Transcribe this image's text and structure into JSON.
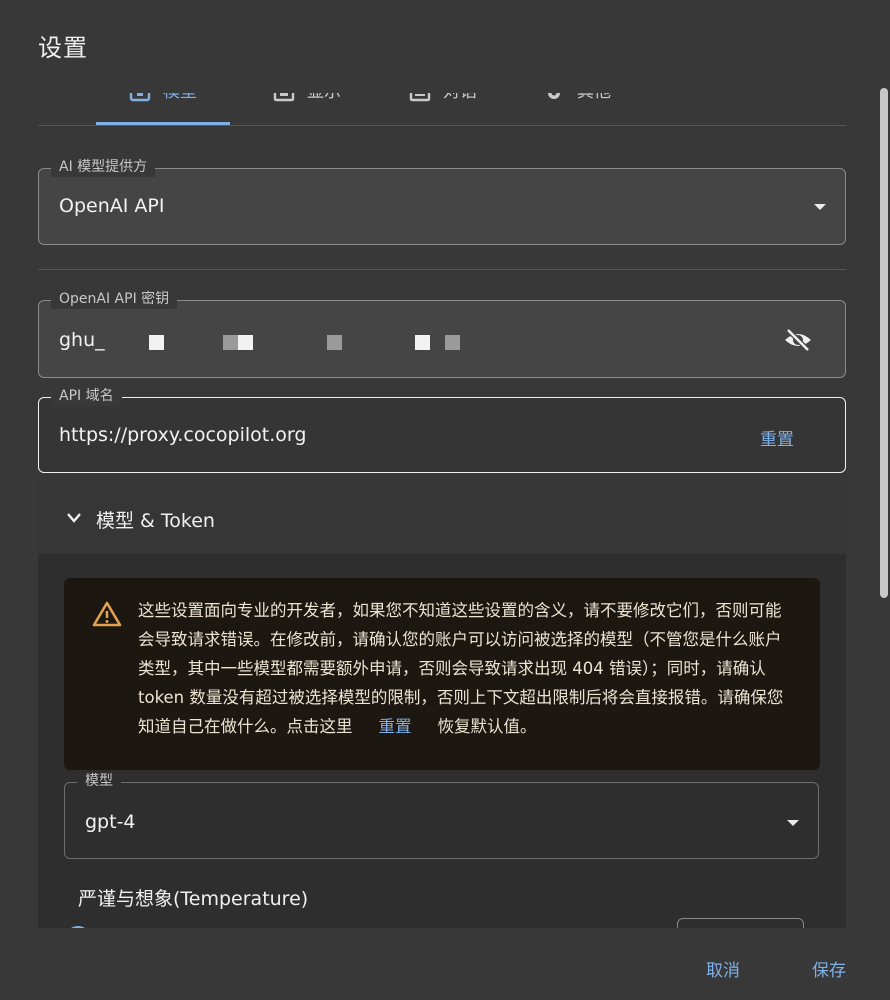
{
  "dialog": {
    "title": "设置"
  },
  "tabs": [
    {
      "label": "模型",
      "icon": "model-icon",
      "active": true
    },
    {
      "label": "显示",
      "icon": "display-icon",
      "active": false
    },
    {
      "label": "对话",
      "icon": "chat-icon",
      "active": false
    },
    {
      "label": "其他",
      "icon": "gear-icon",
      "active": false
    }
  ],
  "provider": {
    "label": "AI 模型提供方",
    "value": "OpenAI API"
  },
  "api_key": {
    "label": "OpenAI API 密钥",
    "value": "ghu_"
  },
  "api_domain": {
    "label": "API 域名",
    "value": "https://proxy.cocopilot.org",
    "reset_label": "重置"
  },
  "advanced": {
    "title": "模型 & Token",
    "warning_text": "这些设置面向专业的开发者，如果您不知道这些设置的含义，请不要修改它们，否则可能会导致请求错误。在修改前，请确认您的账户可以访问被选择的模型（不管您是什么账户类型，其中一些模型都需要额外申请，否则会导致请求出现 404 错误）；同时，请确认 token 数量没有超过被选择模型的限制，否则上下文超出限制后将会直接报错。请确保您知道自己在做什么。点击这里",
    "warning_link": "重置",
    "warning_suffix": "恢复默认值。"
  },
  "model": {
    "label": "模型",
    "value": "gpt-4"
  },
  "temperature": {
    "label": "严谨与想象(Temperature)"
  },
  "footer": {
    "cancel_label": "取消",
    "save_label": "保存"
  },
  "colors": {
    "accent": "#7fb1e8",
    "warning": "#e0a050",
    "dialog_bg": "#383838"
  }
}
